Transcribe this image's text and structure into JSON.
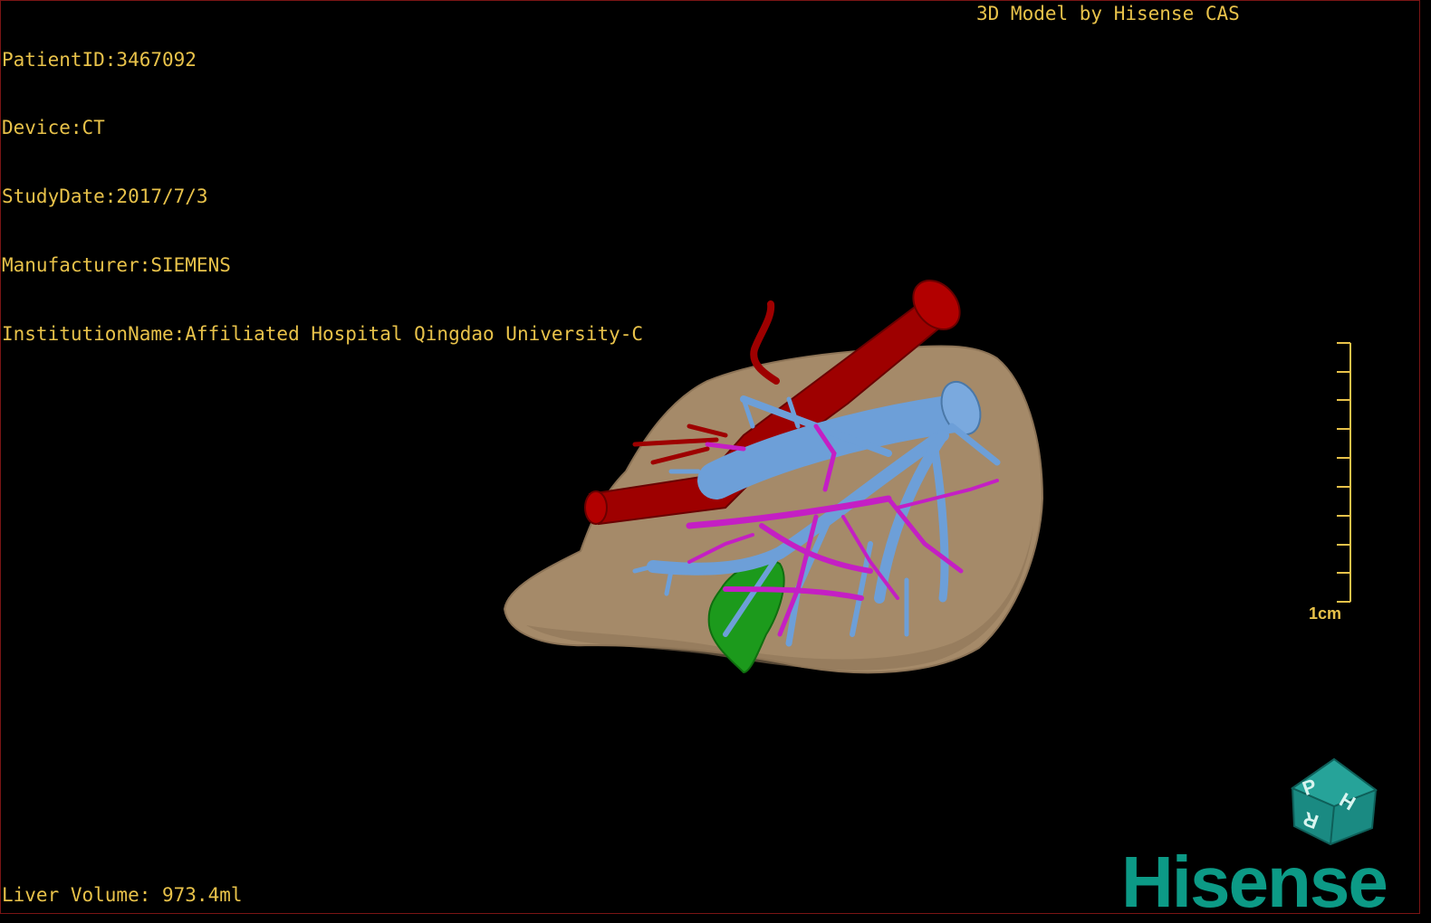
{
  "header": {
    "patient_id": "PatientID:3467092",
    "device": "Device:CT",
    "study_date": "StudyDate:2017/7/3",
    "manufacturer": "Manufacturer:SIEMENS",
    "institution": "InstitutionName:Affiliated Hospital Qingdao University-C"
  },
  "brand_tag": "3D Model by Hisense CAS",
  "footer": {
    "liver_volume": "Liver Volume: 973.4ml"
  },
  "scale_bar": {
    "label": "1cm",
    "ticks": 10
  },
  "orientation_cube": {
    "faces": [
      "P",
      "H",
      "R"
    ],
    "color": "#1a8a82"
  },
  "logo": {
    "text": "Hisense",
    "color": "#0c9a86"
  },
  "colors": {
    "text": "#e8c24a",
    "liver": "#a58a69",
    "aorta": "#9e0000",
    "portal_vein": "#6d9fd8",
    "hepatic_artery": "#c41fc4",
    "gallbladder": "#1c9a1c"
  }
}
